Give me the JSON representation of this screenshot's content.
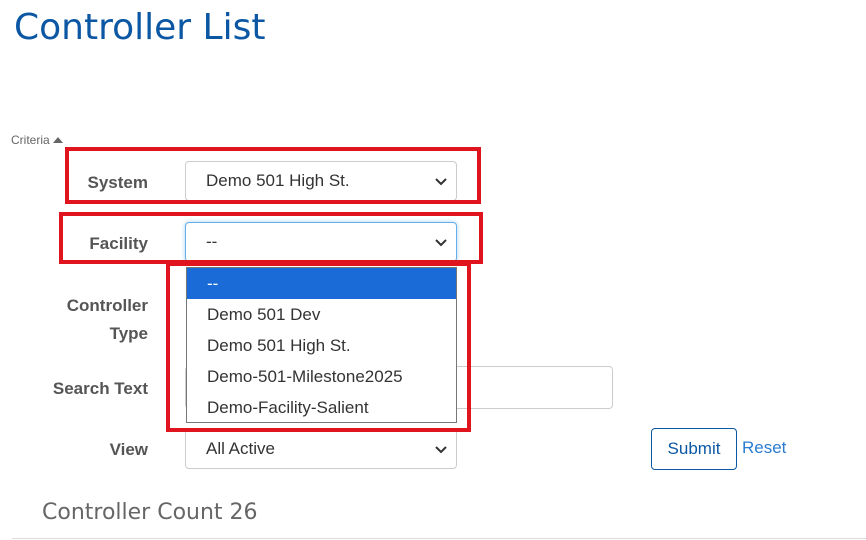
{
  "page": {
    "title": "Controller List"
  },
  "criteria": {
    "toggle_label": "Criteria"
  },
  "form": {
    "system": {
      "label": "System",
      "value": "Demo 501 High St."
    },
    "facility": {
      "label": "Facility",
      "value": "--",
      "options": [
        "--",
        "Demo 501 Dev",
        "Demo 501 High St.",
        "Demo-501-Milestone2025",
        "Demo-Facility-Salient"
      ],
      "selected_index": 0
    },
    "controller_type": {
      "label_line1": "Controller",
      "label_line2": "Type"
    },
    "search_text": {
      "label": "Search Text",
      "value": ""
    },
    "view": {
      "label": "View",
      "value": "All Active"
    },
    "submit_label": "Submit",
    "reset_label": "Reset"
  },
  "results": {
    "count_text": "Controller Count 26"
  },
  "colors": {
    "title": "#0b57a4",
    "highlight": "#e0141e",
    "selected_option": "#1a6ad7",
    "link": "#2a7bd1"
  },
  "icons": {
    "criteria_toggle": "caret-up-icon",
    "select_arrow": "chevron-down-icon"
  }
}
